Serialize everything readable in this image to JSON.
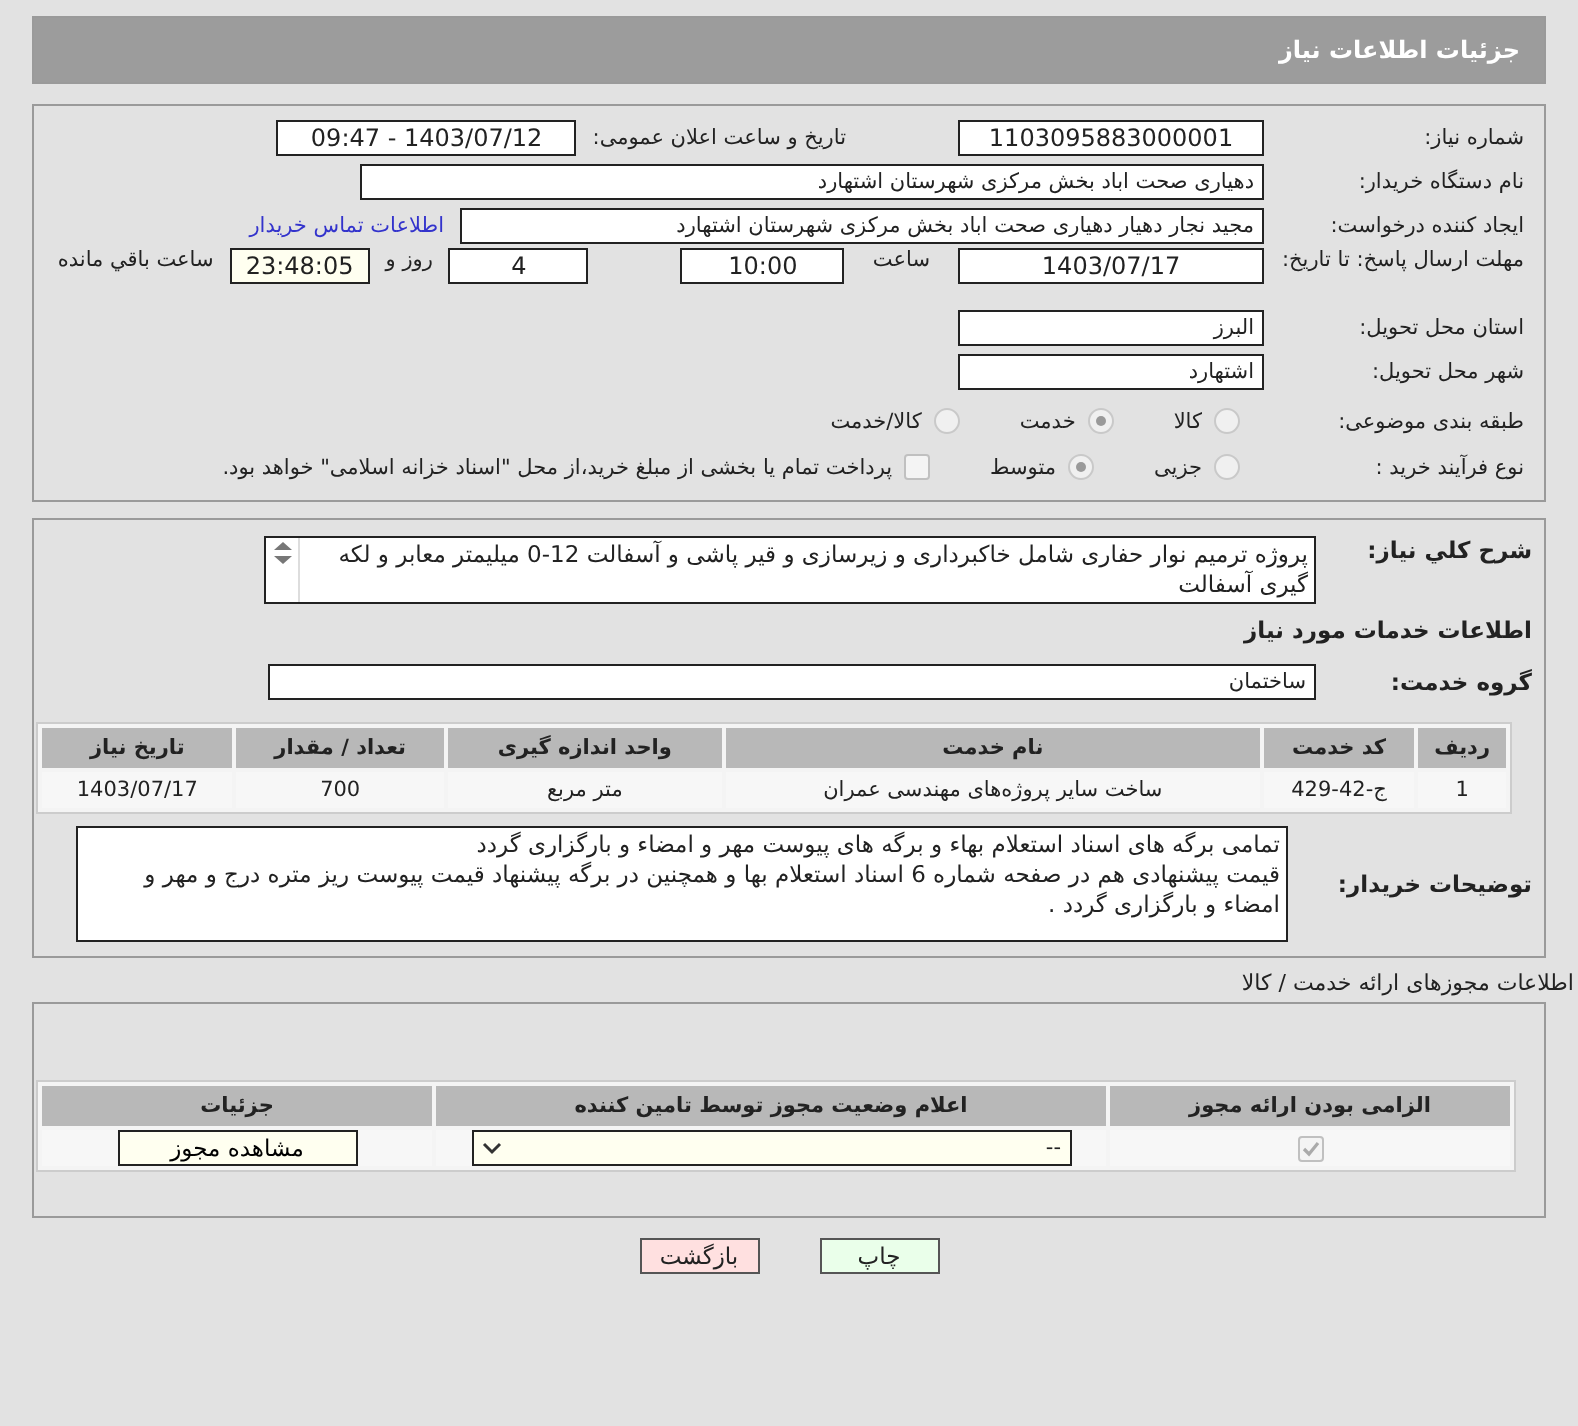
{
  "title": "جزئیات اطلاعات نیاز",
  "need_number": {
    "label": "شماره نیاز:",
    "value": "1103095883000001"
  },
  "announce": {
    "label": "تاریخ و ساعت اعلان عمومی:",
    "value": "1403/07/12 - 09:47"
  },
  "buyer": {
    "label": "نام دستگاه خریدار:",
    "value": "دهیاری صحت اباد بخش مرکزی شهرستان اشتهارد"
  },
  "creator": {
    "label": "ایجاد کننده درخواست:",
    "value": "مجید نجار دهیار دهیاری صحت اباد بخش مرکزی شهرستان اشتهارد",
    "link": "اطلاعات تماس خریدار"
  },
  "deadline": {
    "label": "مهلت ارسال پاسخ: تا تاریخ:",
    "date": "1403/07/17",
    "time_label": "ساعت",
    "time": "10:00",
    "days": "4",
    "days_label": "روز و",
    "remaining": "23:48:05",
    "remaining_label": "ساعت باقي مانده"
  },
  "province": {
    "label": "استان محل تحویل:",
    "value": "البرز"
  },
  "city": {
    "label": "شهر محل تحویل:",
    "value": "اشتهارد"
  },
  "category": {
    "label": "طبقه بندی موضوعی:",
    "options": [
      {
        "label": "کالا",
        "selected": false
      },
      {
        "label": "خدمت",
        "selected": true
      },
      {
        "label": "کالا/خدمت",
        "selected": false
      }
    ]
  },
  "process": {
    "label": "نوع فرآیند خرید :",
    "options": [
      {
        "label": "جزیی",
        "selected": false
      },
      {
        "label": "متوسط",
        "selected": true
      }
    ],
    "treasury": {
      "checked": false,
      "label": "پرداخت تمام یا بخشی از مبلغ خرید،از محل \"اسناد خزانه اسلامی\" خواهد بود."
    }
  },
  "description": {
    "label": "شرح کلي نیاز:",
    "value": "پروژه ترمیم نوار حفاری شامل خاکبرداری و زیرسازی و قیر پاشی و آسفالت 12-0 میلیمتر معابر و لکه گیری آسفالت"
  },
  "services_title": "اطلاعات خدمات مورد نیاز",
  "service_group": {
    "label": "گروه خدمت:",
    "value": "ساختمان"
  },
  "table": {
    "columns": [
      "ردیف",
      "کد خدمت",
      "نام خدمت",
      "واحد اندازه گیری",
      "تعداد / مقدار",
      "تاریخ نیاز"
    ],
    "rows": [
      [
        "1",
        "ج-42-429",
        "ساخت سایر پروژه‌های مهندسی عمران",
        "متر مربع",
        "700",
        "1403/07/17"
      ]
    ]
  },
  "buyer_notes": {
    "label": "توضیحات خریدار:",
    "value": "تمامی برگه های اسناد استعلام بهاء و برگه های پیوست مهر و امضاء و بارگزاری گردد\nقیمت پیشنهادی هم در صفحه شماره 6 اسناد استعلام بها و همچنین در برگه پیشنهاد قیمت پیوست ریز متره درج و مهر و امضاء و بارگزاری گردد ."
  },
  "permits_title": "اطلاعات مجوزهای ارائه خدمت / کالا",
  "permits": {
    "columns": [
      "الزامی بودن ارائه مجوز",
      "اعلام وضعیت مجوز توسط تامین کننده",
      "جزئیات"
    ],
    "rows": [
      {
        "required": true,
        "status": "--",
        "action": "مشاهده مجوز"
      }
    ]
  },
  "buttons": [
    {
      "label": "چاپ",
      "kind": "print"
    },
    {
      "label": "بازگشت",
      "kind": "back"
    }
  ]
}
